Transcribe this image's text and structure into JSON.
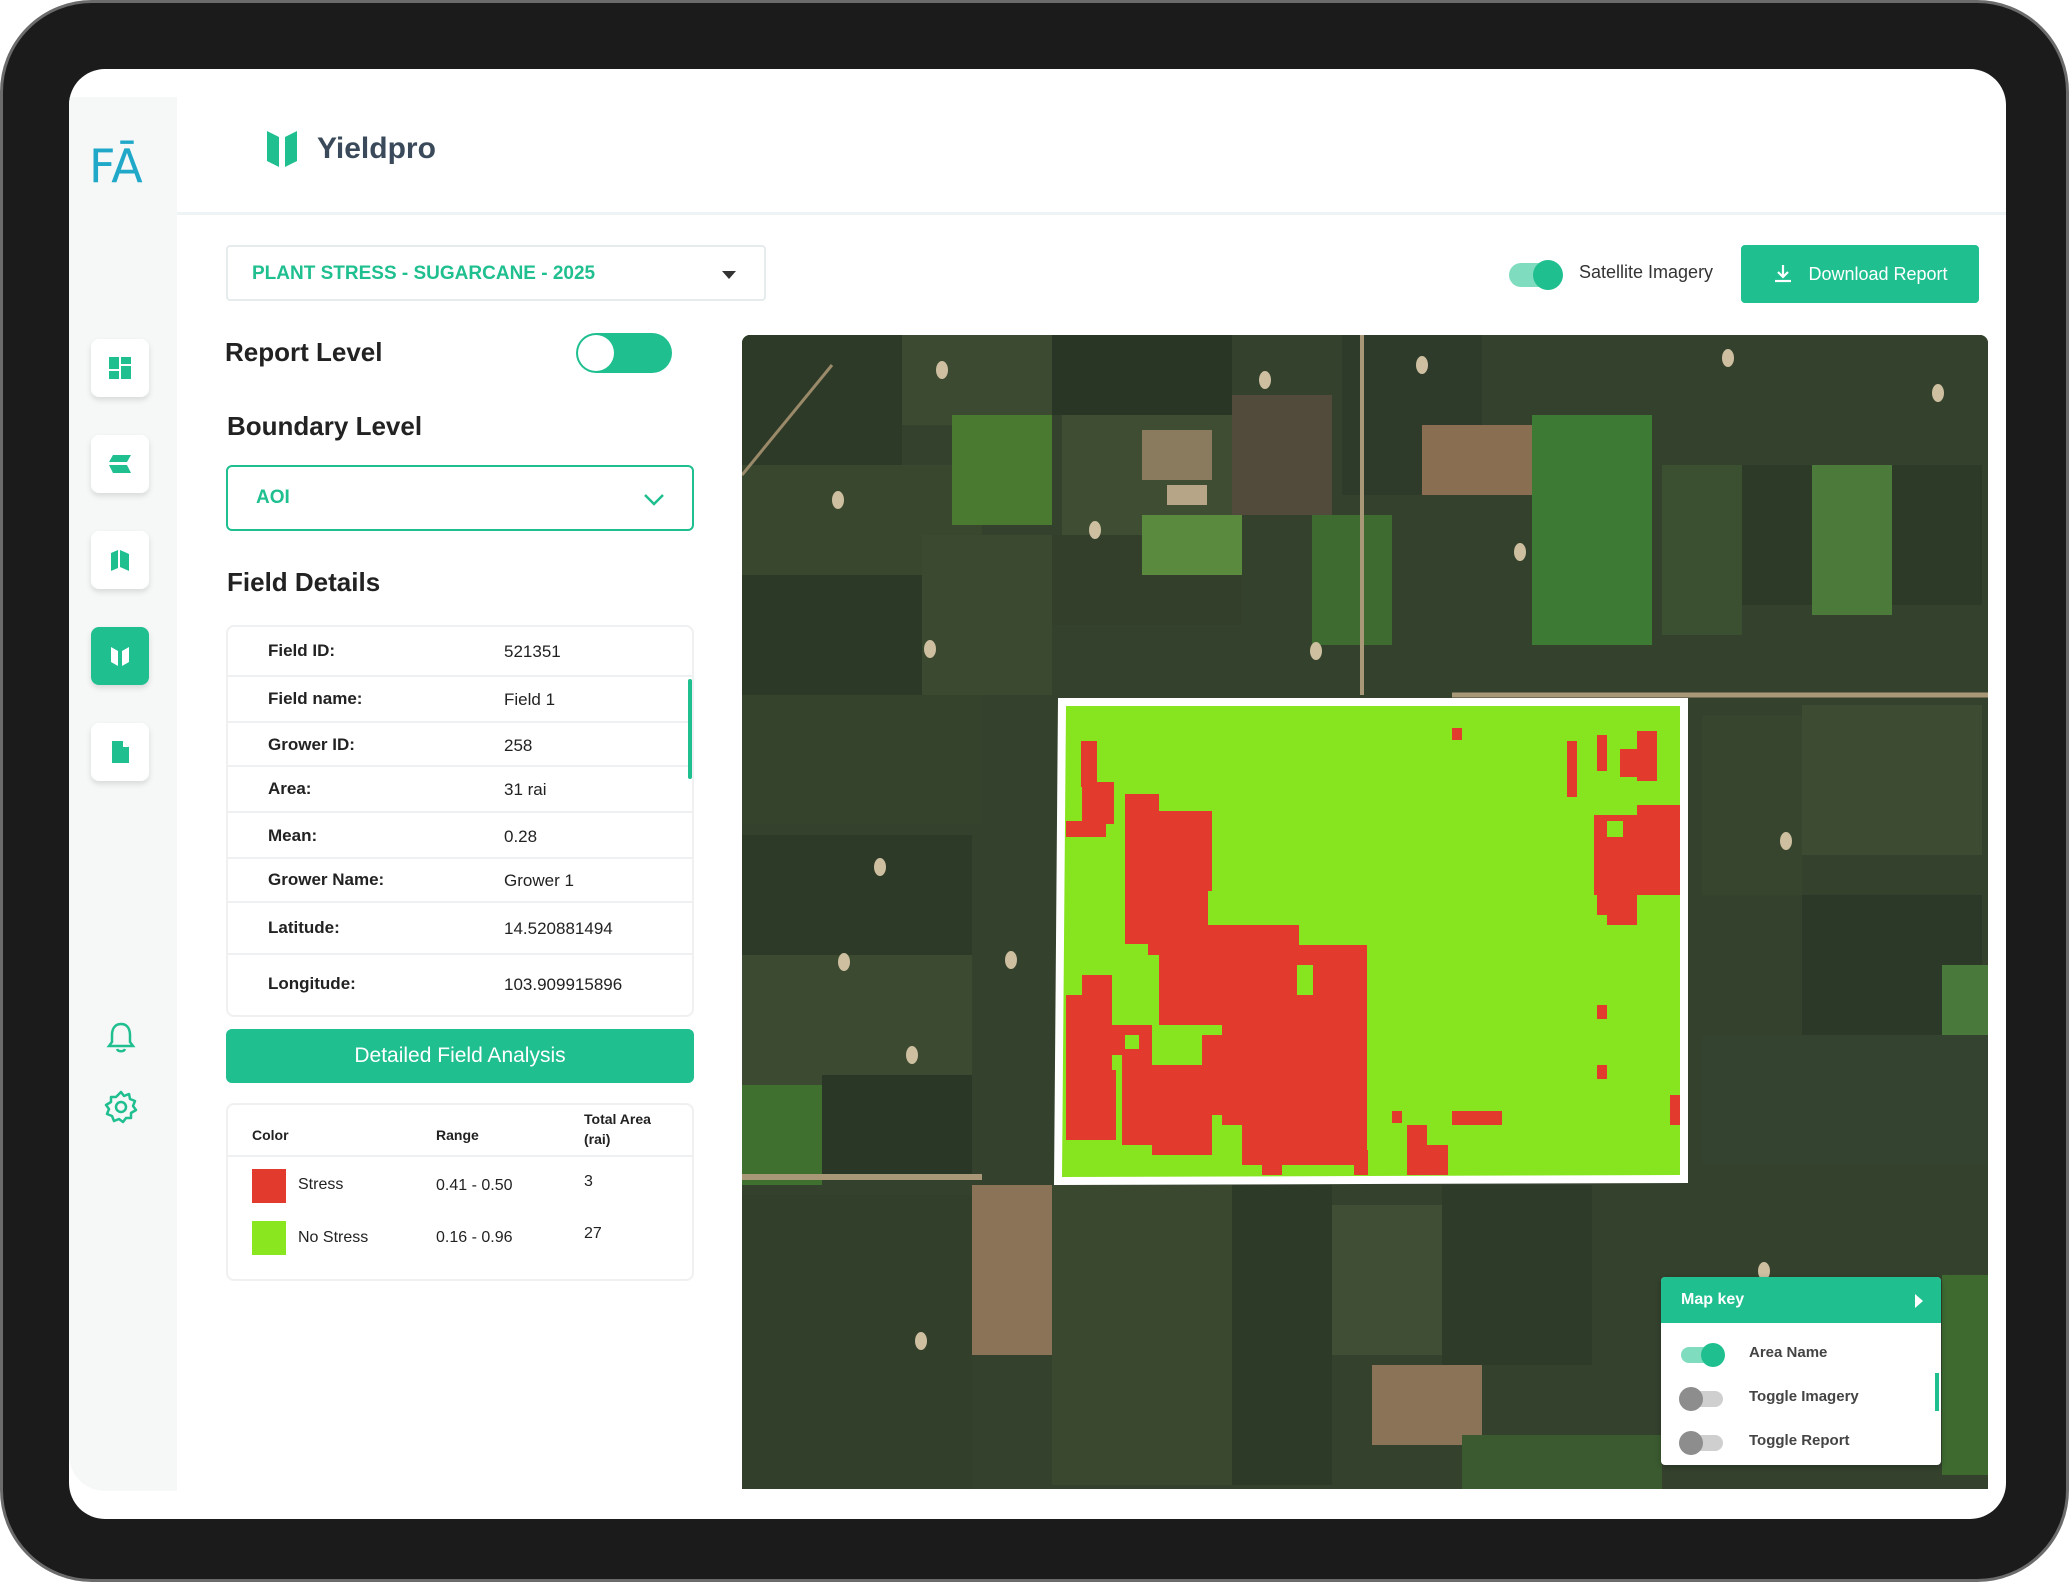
{
  "app": {
    "brand_short": "FĀ",
    "brand_name": "Yieldpro"
  },
  "report_selector": {
    "value": "PLANT STRESS - SUGARCANE - 2025"
  },
  "satellite_toggle": {
    "label": "Satellite Imagery",
    "on": true
  },
  "download_button": {
    "label": "Download Report"
  },
  "report_level": {
    "label": "Report Level",
    "on": true
  },
  "boundary_level": {
    "label": "Boundary Level",
    "value": "AOI"
  },
  "field_details": {
    "title": "Field Details",
    "rows": [
      {
        "key": "Field ID:",
        "value": "521351"
      },
      {
        "key": "Field name:",
        "value": "Field 1"
      },
      {
        "key": "Grower ID:",
        "value": "258"
      },
      {
        "key": "Area:",
        "value": "31 rai"
      },
      {
        "key": "Mean:",
        "value": "0.28"
      },
      {
        "key": "Grower Name:",
        "value": "Grower 1"
      },
      {
        "key": "Latitude:",
        "value": "14.520881494"
      },
      {
        "key": "Longitude:",
        "value": "103.909915896"
      }
    ]
  },
  "analysis_button": {
    "label": "Detailed Field Analysis"
  },
  "legend": {
    "headers": {
      "color": "Color",
      "range": "Range",
      "total_area": "Total Area\n(rai)"
    },
    "rows": [
      {
        "name": "Stress",
        "color": "#e23b2e",
        "range": "0.41 - 0.50",
        "area": "3"
      },
      {
        "name": "No Stress",
        "color": "#8ae61e",
        "range": "0.16 - 0.96",
        "area": "27"
      }
    ]
  },
  "map_key": {
    "title": "Map key",
    "items": [
      {
        "label": "Area Name",
        "on": true
      },
      {
        "label": "Toggle Imagery",
        "on": false
      },
      {
        "label": "Toggle Report",
        "on": false
      }
    ]
  },
  "colors": {
    "accent": "#1fbf8f",
    "stress": "#e23b2e",
    "no_stress": "#8ae61e"
  }
}
